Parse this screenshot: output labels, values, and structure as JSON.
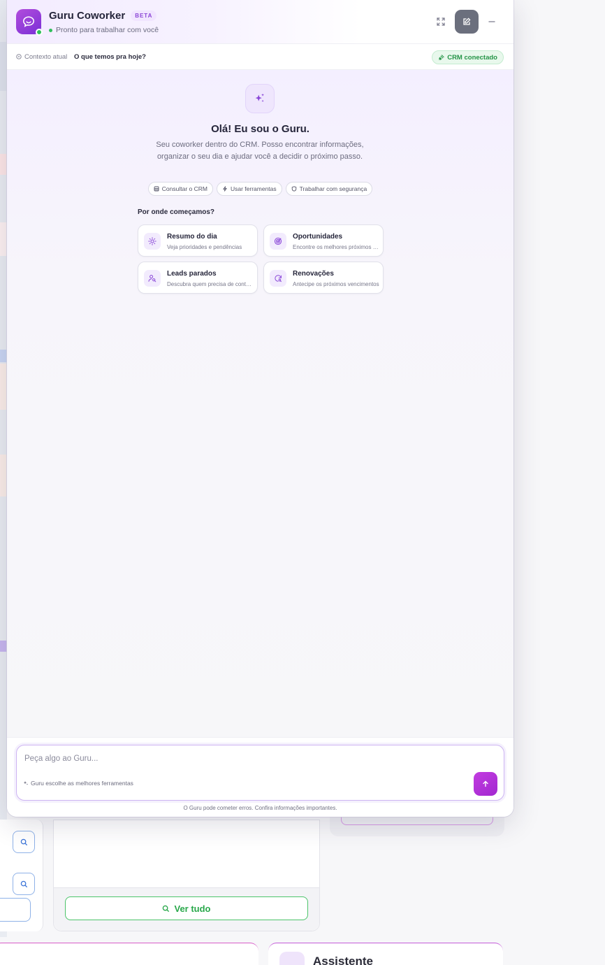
{
  "header": {
    "title": "Guru Coworker",
    "badge": "BETA",
    "status": "Pronto para trabalhar com você",
    "actions": [
      "expand-icon",
      "edit-icon",
      "minimize-icon"
    ]
  },
  "context": {
    "label": "Contexto atual",
    "value": "O que temos pra hoje?",
    "crm_status": "CRM conectado"
  },
  "welcome": {
    "title": "Olá! Eu sou o Guru.",
    "subtitle": "Seu coworker dentro do CRM. Posso encontrar informações, organizar o seu dia e ajudar você a decidir o próximo passo.",
    "chips": [
      {
        "label": "Consultar o CRM",
        "icon": "database-icon"
      },
      {
        "label": "Usar ferramentas",
        "icon": "bolt-icon"
      },
      {
        "label": "Trabalhar com segurança",
        "icon": "shield-icon"
      }
    ],
    "start_label": "Por onde começamos?",
    "cards": [
      {
        "title": "Resumo do dia",
        "desc": "Veja prioridades e pendências",
        "icon": "sun-icon"
      },
      {
        "title": "Oportunidades",
        "desc": "Encontre os melhores próximos negócios",
        "icon": "target-icon"
      },
      {
        "title": "Leads parados",
        "desc": "Descubra quem precisa de contato",
        "icon": "user-search-icon"
      },
      {
        "title": "Renovações",
        "desc": "Antecipe os próximos vencimentos",
        "icon": "refresh-icon"
      }
    ]
  },
  "composer": {
    "placeholder": "Peça algo ao Guru...",
    "hint": "Guru escolhe as melhores ferramentas",
    "disclaimer": "O Guru pode cometer erros. Confira informações importantes."
  },
  "background": {
    "ver_tudo": "Ver tudo",
    "assistente": "Assistente"
  },
  "colors": {
    "accent": "#a228d0",
    "brand_purple": "#8b45d6",
    "success": "#2fbf5b"
  }
}
